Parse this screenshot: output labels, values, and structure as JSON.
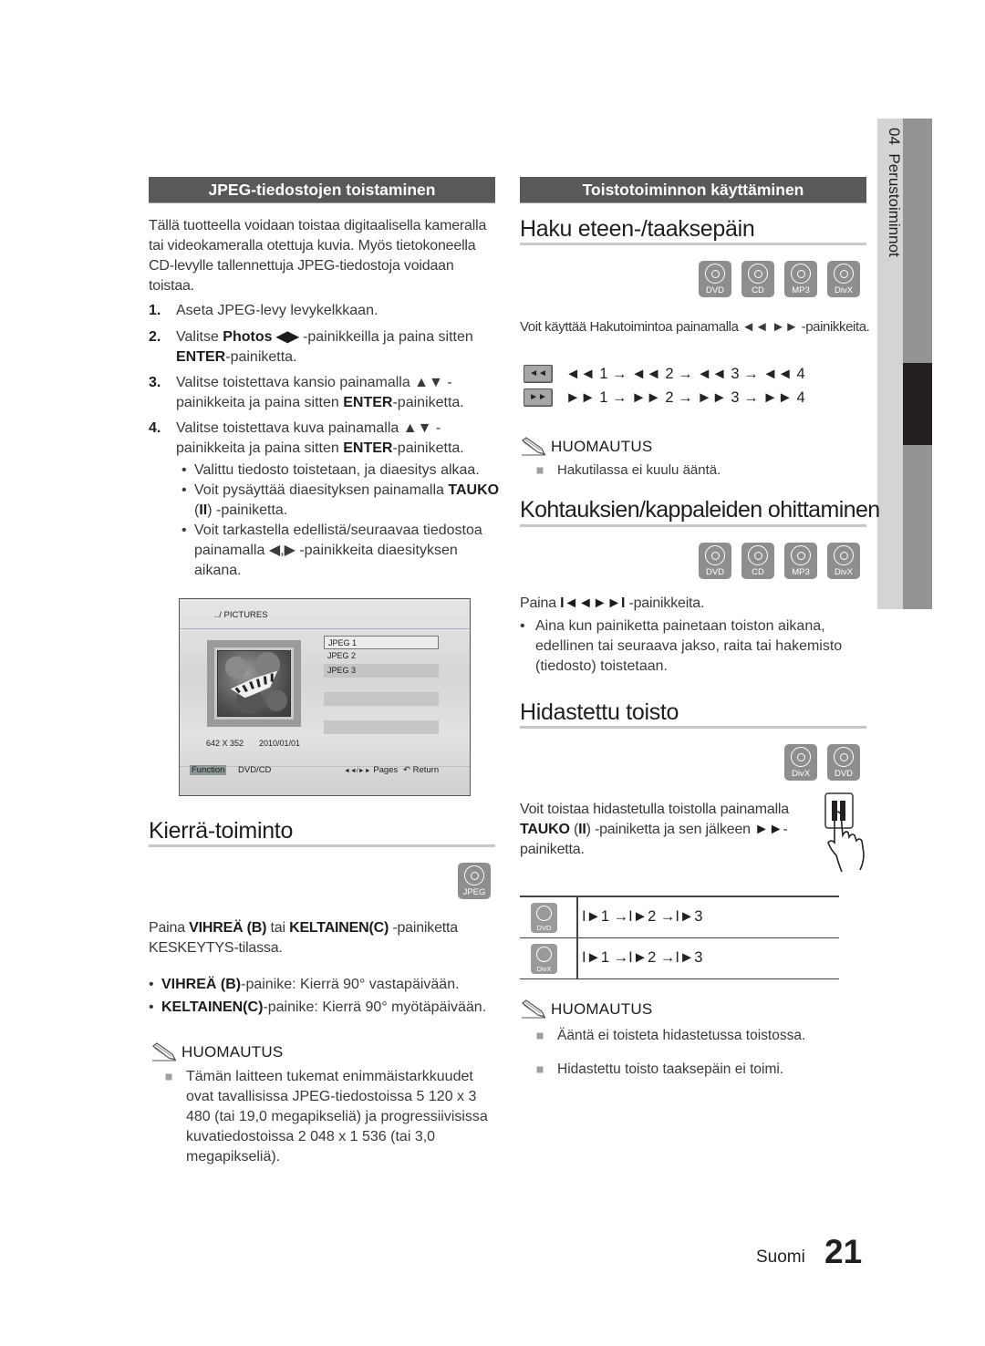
{
  "side_tab": {
    "chapter": "04",
    "title": "Perustoiminnot"
  },
  "left": {
    "section_title": "JPEG-tiedostojen toistaminen",
    "intro": "Tällä tuotteella voidaan toistaa digitaalisella kameralla tai videokameralla otettuja kuvia. Myös tietokoneella CD-levylle tallennettuja JPEG-tiedostoja voidaan toistaa.",
    "steps": [
      {
        "num": "1.",
        "parts": [
          {
            "t": "Aseta JPEG-levy levykelkkaan."
          }
        ]
      },
      {
        "num": "2.",
        "parts": [
          {
            "t": "Valitse "
          },
          {
            "t": "Photos ◀▶",
            "b": true
          },
          {
            "t": " -painikkeilla ja paina sitten "
          },
          {
            "t": "ENTER",
            "b": true
          },
          {
            "t": "-painiketta."
          }
        ]
      },
      {
        "num": "3.",
        "parts": [
          {
            "t": "Valitse toistettava kansio painamalla ▲▼ -painikkeita ja paina sitten "
          },
          {
            "t": "ENTER",
            "b": true
          },
          {
            "t": "-painiketta."
          }
        ]
      },
      {
        "num": "4.",
        "parts": [
          {
            "t": "Valitse toistettava kuva painamalla ▲▼ -painikkeita ja paina sitten "
          },
          {
            "t": "ENTER",
            "b": true
          },
          {
            "t": "-painiketta."
          }
        ]
      }
    ],
    "bullets": [
      {
        "parts": [
          {
            "t": "Valittu tiedosto toistetaan, ja diaesitys alkaa."
          }
        ]
      },
      {
        "parts": [
          {
            "t": "Voit pysäyttää diaesityksen painamalla "
          },
          {
            "t": "TAUKO",
            "b": true
          },
          {
            "t": " ("
          },
          {
            "t": "II",
            "b": true
          },
          {
            "t": ") -painiketta."
          }
        ]
      },
      {
        "parts": [
          {
            "t": "Voit tarkastella edellistä/seuraavaa tiedostoa painamalla ◀,▶ -painikkeita diaesityksen aikana."
          }
        ]
      }
    ],
    "browser": {
      "path": "../ PICTURES",
      "files": [
        "JPEG 1",
        "JPEG 2",
        "JPEG 3"
      ],
      "selected_index": 0,
      "resolution": "642 X 352",
      "date": "2010/01/01",
      "function_label": "Function",
      "source_label": "DVD/CD",
      "pages_icon": "◄◄/►►",
      "pages_label": "Pages",
      "return_icon": "↶",
      "return_label": "Return"
    },
    "rotate": {
      "heading": "Kierrä-toiminto",
      "disc_label": "JPEG",
      "para_parts": [
        {
          "t": "Paina "
        },
        {
          "t": "VIHREÄ (B)",
          "b": true
        },
        {
          "t": " tai  "
        },
        {
          "t": "KELTAINEN(C)",
          "b": true
        },
        {
          "t": " -painiketta KESKEYTYS-tilassa."
        }
      ],
      "bullets": [
        {
          "parts": [
            {
              "t": "VIHREÄ (B)",
              "b": true
            },
            {
              "t": "-painike: Kierrä 90° vastapäivään."
            }
          ]
        },
        {
          "parts": [
            {
              "t": "KELTAINEN(C)",
              "b": true
            },
            {
              "t": "-painike: Kierrä 90° myötäpäivään."
            }
          ]
        }
      ],
      "note_title": "HUOMAUTUS",
      "notes": [
        "Tämän laitteen tukemat enimmäistarkkuudet ovat tavallisissa JPEG-tiedostoissa 5 120 x 3 480 (tai 19,0 megapikseliä) ja progressiivisissa kuvatiedostoissa 2 048 x 1 536 (tai 3,0 megapikseliä)."
      ]
    }
  },
  "right": {
    "section_title": "Toistotoiminnon käyttäminen",
    "search": {
      "heading": "Haku eteen-/taaksepäin",
      "discs": [
        "DVD",
        "CD",
        "MP3",
        "DivX"
      ],
      "para": "Voit käyttää Hakutoimintoa painamalla ◄◄ ►► -painikkeita.",
      "rewind_button": "◄◄",
      "forward_button": "►►",
      "rewind_seq": "◄◄ 1 → ◄◄ 2 → ◄◄ 3 → ◄◄ 4",
      "forward_seq": "►► 1 → ►► 2 → ►► 3 → ►► 4",
      "note_title": "HUOMAUTUS",
      "notes": [
        "Hakutilassa ei kuulu ääntä."
      ]
    },
    "skip": {
      "heading": "Kohtauksien/kappaleiden ohittaminen",
      "discs": [
        "DVD",
        "CD",
        "MP3",
        "DivX"
      ],
      "para_parts": [
        {
          "t": "Paina "
        },
        {
          "t": "I◄◄►►I",
          "b": true
        },
        {
          "t": " -painikkeita."
        }
      ],
      "bullets": [
        {
          "parts": [
            {
              "t": "Aina kun painiketta painetaan toiston aikana, edellinen tai seuraava jakso, raita tai hakemisto (tiedosto) toistetaan."
            }
          ]
        }
      ]
    },
    "slow": {
      "heading": "Hidastettu toisto",
      "discs": [
        "DivX",
        "DVD"
      ],
      "para_parts": [
        {
          "t": "Voit toistaa hidastetulla toistolla painamalla "
        },
        {
          "t": "TAUKO",
          "b": true
        },
        {
          "t": " ("
        },
        {
          "t": "II",
          "b": true
        },
        {
          "t": ") -painiketta ja sen jälkeen "
        },
        {
          "t": "►►",
          "b": true
        },
        {
          "t": "-painiketta."
        }
      ],
      "table": [
        {
          "disc": "DVD",
          "seq": "I►1 →I►2 →I►3"
        },
        {
          "disc": "DivX",
          "seq": "I►1 →I►2 →I►3"
        }
      ],
      "note_title": "HUOMAUTUS",
      "notes": [
        "Ääntä ei toisteta hidastetussa toistossa.",
        "Hidastettu toisto taaksepäin ei toimi."
      ]
    }
  },
  "footer": {
    "language": "Suomi",
    "page_number": "21"
  }
}
